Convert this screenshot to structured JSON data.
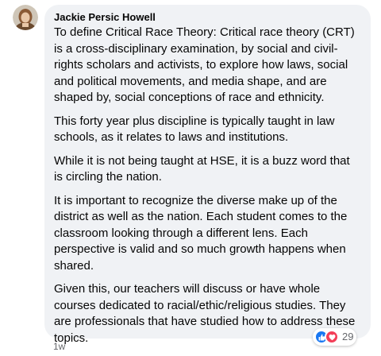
{
  "comment": {
    "author": "Jackie Persic Howell",
    "paragraphs": [
      "To define Critical Race Theory: Critical race theory (CRT) is a cross-disciplinary examination, by social and civil-rights scholars and activists, to explore how laws, social and political movements, and media shape, and are shaped by, social conceptions of race and ethnicity.",
      "This forty year plus discipline is typically taught in law schools, as it relates to laws and institutions.",
      "While it is not being taught at HSE, it is a buzz word that is circling the nation.",
      "It is important to recognize the diverse make up of the district as well as the nation. Each student comes to the classroom looking through a different lens. Each perspective is valid and so much growth happens when shared.",
      "Given this, our teachers will discuss or have whole courses dedicated to racial/ethic/religious studies. They are professionals that have studied how to address these topics."
    ],
    "timestamp": "1w"
  },
  "reactions": {
    "icons": [
      "like-icon",
      "love-icon"
    ],
    "count": "29"
  },
  "colors": {
    "bubble_bg": "#f0f2f5",
    "text": "#050505",
    "meta": "#65676b",
    "like": "#1877f2",
    "love": "#f33e58"
  }
}
